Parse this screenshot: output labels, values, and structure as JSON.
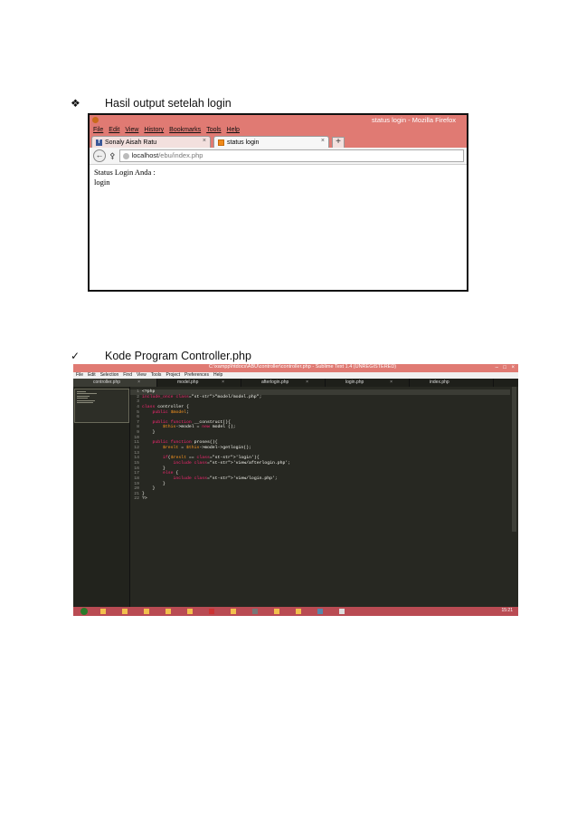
{
  "bullets": [
    {
      "symbol": "❖",
      "text": "Hasil output setelah login"
    },
    {
      "symbol": "✓",
      "text": "Kode Program Controller.php"
    }
  ],
  "firefox": {
    "window_title": "status login - Mozilla Firefox",
    "menu": [
      "File",
      "Edit",
      "View",
      "History",
      "Bookmarks",
      "Tools",
      "Help"
    ],
    "tabs": [
      {
        "label": "Sonaly Aisah Ratu",
        "close": "×"
      },
      {
        "label": "status login",
        "close": "×"
      }
    ],
    "new_tab": "+",
    "url_host": "localhost",
    "url_path": "/ebu/index.php",
    "content": [
      "Status Login Anda :",
      "login"
    ]
  },
  "sublime": {
    "window_title": "C:\\xampp\\htdocs\\ABU\\controller\\controller.php - Sublime Text 1.4 (UNREGISTERED)",
    "menu": [
      "File",
      "Edit",
      "Selection",
      "Find",
      "View",
      "Tools",
      "Project",
      "Preferences",
      "Help"
    ],
    "tabs": [
      "controller.php",
      "model.php",
      "afterlogin.php",
      "login.php",
      "index.php"
    ],
    "tab_close": "×",
    "code": [
      "<?php",
      "include_once \"model/model.php\";",
      "",
      "class controller {",
      "    public $model;",
      "",
      "    public function __construct(){",
      "        $this->model = new model ();",
      "    }",
      "",
      "    public function proses(){",
      "        $reslt = $this->model->getlogin();",
      "",
      "        if($reslt == 'login'){",
      "            include 'view/afterlogin.php';",
      "        }",
      "        else {",
      "            include 'view/login.php';",
      "        }",
      "    }",
      "}",
      "?>"
    ],
    "time": "15:21"
  }
}
